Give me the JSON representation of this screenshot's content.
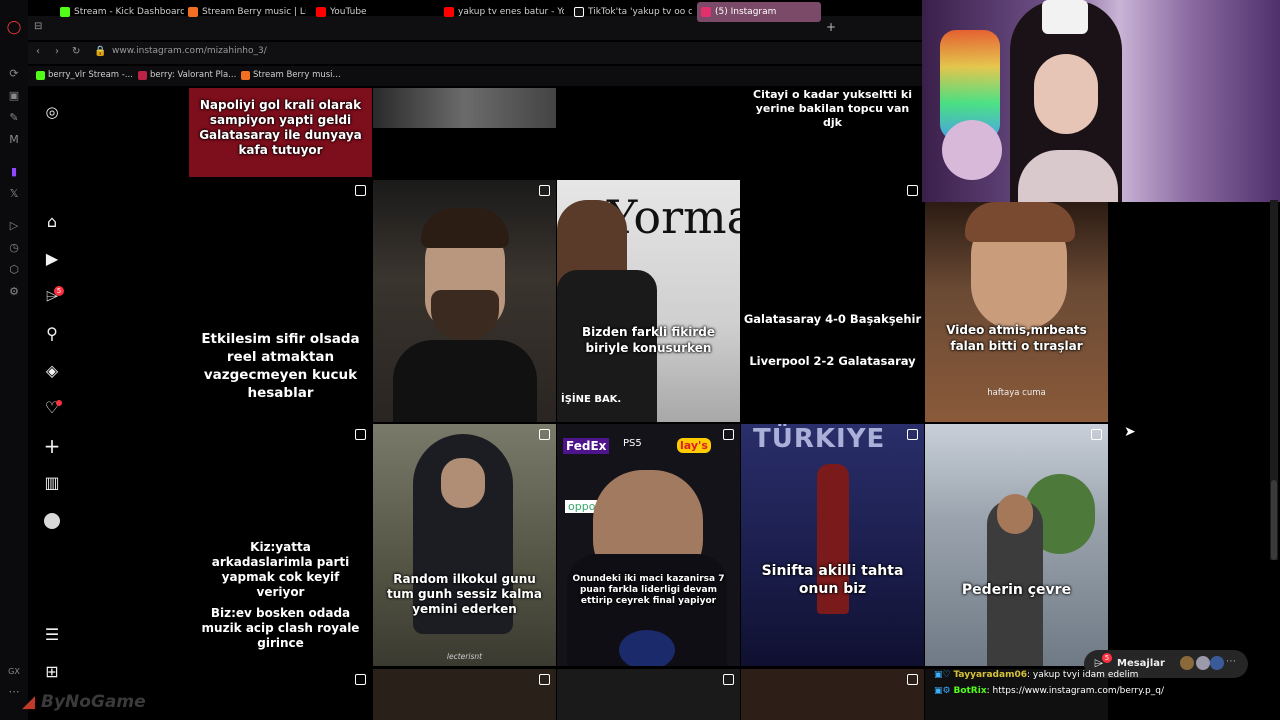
{
  "browser": {
    "tabs": [
      {
        "label": "Stream - Kick Dashboard",
        "color": "#53fc18"
      },
      {
        "label": "Stream Berry music | Liste",
        "color": "#f26f21"
      },
      {
        "label": "YouTube",
        "color": "#ff0000"
      },
      {
        "label": "yakup tv enes batur - You",
        "color": "#ff0000"
      },
      {
        "label": "TikTok'ta 'yakup tv oo don",
        "color": "#ffffff"
      },
      {
        "label": "(5) Instagram",
        "color": "#e1306c"
      }
    ],
    "new_tab": "+",
    "url": "www.instagram.com/mizahinho_3/",
    "bookmarks": [
      {
        "label": "berry_vlr Stream -...",
        "color": "#53fc18"
      },
      {
        "label": "berry: Valorant Pla...",
        "color": "#bb2244"
      },
      {
        "label": "Stream Berry musi...",
        "color": "#f26f21"
      }
    ]
  },
  "instagram": {
    "nav_badge": "5",
    "posts": [
      {
        "caption": "Napoliyi gol krali olarak sampiyon yapti geldi Galatasaray ile dunyaya kafa tutuyor"
      },
      {
        "caption": "Citayi o kadar yukseltti ki yerine bakilan topcu van djk"
      },
      {
        "caption": "Etkilesim sifir olsada reel atmaktan vazgecmeyen kucuk hesablar"
      },
      {
        "caption": "Bizden farkli fikirde biriyle konusurken",
        "overlay_top": "Yorma",
        "overlay_bottom": "İŞİNE BAK."
      },
      {
        "caption_line1": "Galatasaray 4-0 Başakşehir",
        "caption_line2": "Liverpool 2-2 Galatasaray"
      },
      {
        "caption": "Video atmis,mrbeats falan bitti o tıraşlar",
        "sub": "haftaya cuma"
      },
      {
        "caption_line1": "Kiz:yatta arkadaslarimla parti yapmak cok keyif veriyor",
        "caption_line2": "Biz:ev bosken odada muzik acip clash royale girince"
      },
      {
        "caption": "Random ilkokul gunu tum gunh sessiz kalma yemini ederken",
        "sub": "lecterisnt"
      },
      {
        "caption": "Onundeki iki maci kazanirsa 7 puan farkla liderligi devam ettirip ceyrek final yapiyor",
        "logos": [
          "FedEx",
          "lay's",
          "PS5",
          "oppo"
        ]
      },
      {
        "caption": "Sinifta akilli tahta onun biz",
        "overlay_top": "TÜRKIYE"
      },
      {
        "caption": "Pederin çevre"
      }
    ],
    "messages_label": "Mesajlar",
    "messages_badge": "5"
  },
  "chat": [
    {
      "user": "Tayyaradam06",
      "message": ": yakup tvyi idam edelim",
      "user_color": "#d6c33a"
    },
    {
      "user": "BotRix",
      "message": ": https://www.instagram.com/berry.p_q/",
      "user_color": "#53fc18"
    }
  ],
  "watermark": "ByNoGame"
}
